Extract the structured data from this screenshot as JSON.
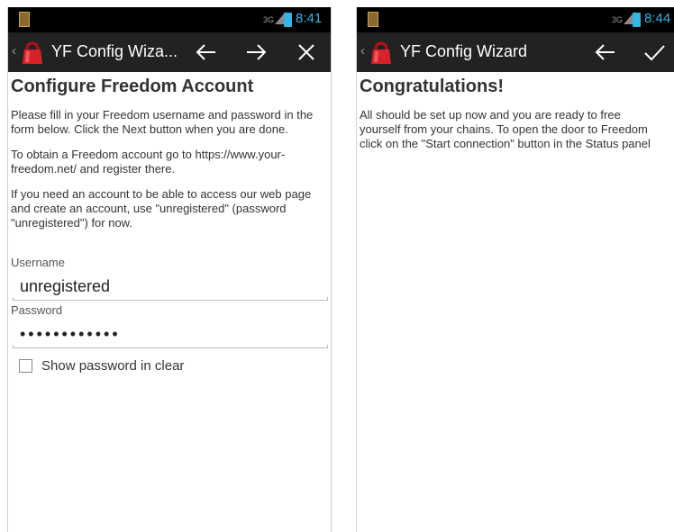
{
  "screens": [
    {
      "status": {
        "time": "8:41",
        "network": "3G"
      },
      "actionbar": {
        "title": "YF Config Wiza...",
        "back_icon": "arrow-left-icon",
        "next_icon": "arrow-right-icon",
        "close_icon": "close-icon"
      },
      "content": {
        "heading": "Configure Freedom Account",
        "paragraphs": [
          "Please fill in your Freedom username and password in the form below. Click the Next button when you are done.",
          "To obtain a Freedom account go to https://www.your-freedom.net/ and register there.",
          "If you need an account to be able to access our web page and create an account, use \"unregistered\" (password \"unregistered\") for now."
        ],
        "username_label": "Username",
        "username_value": "unregistered",
        "password_label": "Password",
        "password_value": "••••••••••••",
        "show_password_label": "Show password in clear"
      }
    },
    {
      "status": {
        "time": "8:44",
        "network": "3G"
      },
      "actionbar": {
        "title": "YF Config Wizard",
        "back_icon": "arrow-left-icon",
        "done_icon": "checkmark-icon"
      },
      "content": {
        "heading": "Congratulations!",
        "paragraph_lines": [
          "All should be set up now and you are ready to free",
          "yourself from your chains. To open the door to Freedom",
          "click on the \"Start connection\" button in the Status panel"
        ]
      }
    }
  ],
  "colors": {
    "status_accent": "#33b5e5",
    "actionbar_bg": "#222222",
    "logo_red": "#d8222a"
  }
}
